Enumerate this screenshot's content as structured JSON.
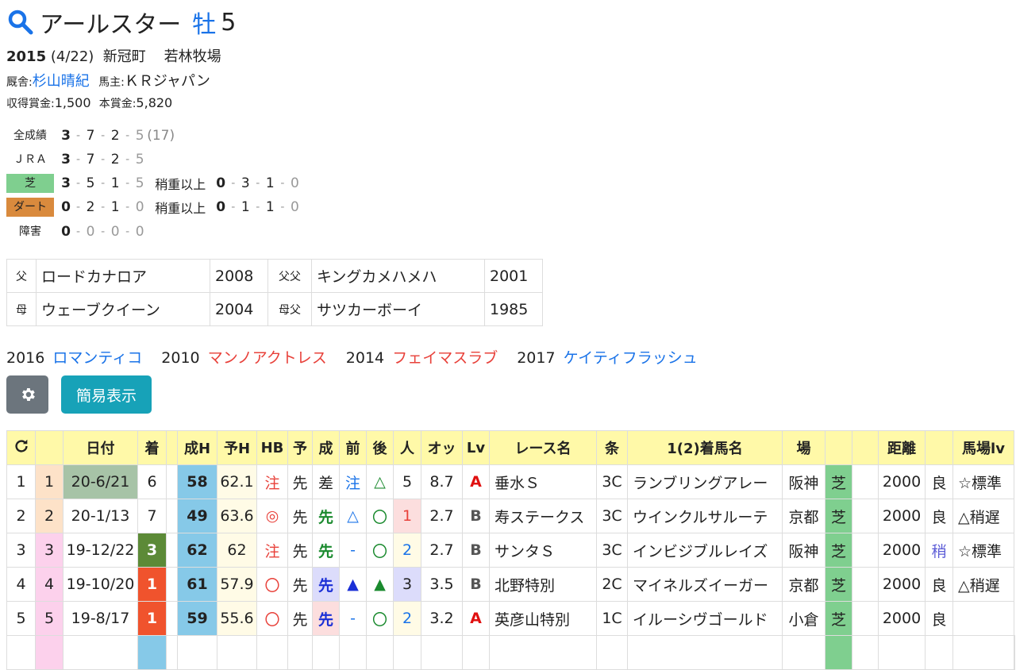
{
  "horse": {
    "name": "アールスター",
    "sex": "牡",
    "age": "5",
    "birth_year": "2015",
    "birth_date": "(4/22)",
    "birth_place": "新冠町",
    "breeder": "若林牧場",
    "trainer_label": "厩舎:",
    "trainer": "杉山晴紀",
    "owner_label": "馬主:",
    "owner": "ＫＲジャパン",
    "earn_label": "収得賞金:",
    "earn": "1,500",
    "prize_label": "本賞金:",
    "prize": "5,820"
  },
  "records": [
    {
      "label": "全成績",
      "kind": "plain",
      "nums": [
        "3",
        "7",
        "2",
        "5"
      ],
      "total": "(17)"
    },
    {
      "label": "ＪＲＡ",
      "kind": "plain",
      "nums": [
        "3",
        "7",
        "2",
        "5"
      ]
    },
    {
      "label": "芝",
      "kind": "turf",
      "nums": [
        "3",
        "5",
        "1",
        "5"
      ],
      "heavy_label": "稍重以上",
      "heavy": [
        "0",
        "3",
        "1",
        "0"
      ]
    },
    {
      "label": "ダート",
      "kind": "dirt",
      "nums": [
        "0",
        "2",
        "1",
        "0"
      ],
      "heavy_label": "稍重以上",
      "heavy": [
        "0",
        "1",
        "1",
        "0"
      ]
    },
    {
      "label": "障害",
      "kind": "plain",
      "nums": [
        "0",
        "0",
        "0",
        "0"
      ]
    }
  ],
  "pedigree": {
    "sire_key": "父",
    "sire": "ロードカナロア",
    "sire_year": "2008",
    "sire_sire_key": "父父",
    "sire_sire": "キングカメハメハ",
    "sire_sire_year": "2001",
    "dam_key": "母",
    "dam": "ウェーブクイーン",
    "dam_year": "2004",
    "dam_sire_key": "母父",
    "dam_sire": "サツカーボーイ",
    "dam_sire_year": "1985"
  },
  "siblings": [
    {
      "year": "2016",
      "name": "ロマンティコ",
      "color": "#1a73e8"
    },
    {
      "year": "2010",
      "name": "マンノアクトレス",
      "color": "#e8413a"
    },
    {
      "year": "2014",
      "name": "フェイマスラブ",
      "color": "#e8413a"
    },
    {
      "year": "2017",
      "name": "ケイティフラッシュ",
      "color": "#1a73e8"
    }
  ],
  "buttons": {
    "settings_icon": "gear-icon",
    "simple_view": "簡易表示"
  },
  "table": {
    "refresh_icon": "refresh-icon",
    "headers": [
      "",
      "日付",
      "着",
      "",
      "成H",
      "予H",
      "HB",
      "予",
      "成",
      "前",
      "後",
      "人",
      "オッ",
      "Lv",
      "レース名",
      "条",
      "1(2)着馬名",
      "場",
      "",
      "",
      "距離",
      "",
      "馬場lv"
    ],
    "rows": [
      {
        "no": "1",
        "rank": "1",
        "date": "20-6/21",
        "chaku": "6",
        "seiH": "58",
        "yoH": "62.1",
        "hb": "注",
        "yo": "先",
        "sei": "差",
        "mae": "注",
        "ato": "△",
        "ninki": "5",
        "odds": "8.7",
        "lv": "A",
        "race": "垂水Ｓ",
        "jou": "3C",
        "winner": "ランブリングアレー",
        "ba": "阪神",
        "surface": "芝",
        "dist": "2000",
        "cond": "良",
        "babalv": "☆標準"
      },
      {
        "no": "2",
        "rank": "2",
        "date": "20-1/13",
        "chaku": "7",
        "seiH": "49",
        "yoH": "63.6",
        "hb": "◎",
        "yo": "先",
        "sei": "先",
        "mae": "△",
        "ato": "〇",
        "ninki": "1",
        "odds": "2.7",
        "lv": "B",
        "race": "寿ステークス",
        "jou": "3C",
        "winner": "ウインクルサルーテ",
        "ba": "京都",
        "surface": "芝",
        "dist": "2000",
        "cond": "良",
        "babalv": "△稍遅"
      },
      {
        "no": "3",
        "rank": "3",
        "date": "19-12/22",
        "chaku": "3",
        "seiH": "62",
        "yoH": "62",
        "hb": "注",
        "yo": "先",
        "sei": "先",
        "mae": "-",
        "ato": "〇",
        "ninki": "2",
        "odds": "2.7",
        "lv": "B",
        "race": "サンタＳ",
        "jou": "3C",
        "winner": "インビジブルレイズ",
        "ba": "阪神",
        "surface": "芝",
        "dist": "2000",
        "cond": "稍",
        "babalv": "☆標準"
      },
      {
        "no": "4",
        "rank": "4",
        "date": "19-10/20",
        "chaku": "1",
        "seiH": "61",
        "yoH": "57.9",
        "hb": "〇",
        "yo": "先",
        "sei": "先",
        "mae": "▲",
        "ato": "▲",
        "ninki": "3",
        "odds": "3.5",
        "lv": "B",
        "race": "北野特別",
        "jou": "2C",
        "winner": "マイネルズイーガー",
        "ba": "京都",
        "surface": "芝",
        "dist": "2000",
        "cond": "良",
        "babalv": "△稍遅"
      },
      {
        "no": "5",
        "rank": "5",
        "date": "19-8/17",
        "chaku": "1",
        "seiH": "59",
        "yoH": "55.6",
        "hb": "〇",
        "yo": "先",
        "sei": "先",
        "mae": "-",
        "ato": "〇",
        "ninki": "2",
        "odds": "3.2",
        "lv": "A",
        "race": "英彦山特別",
        "jou": "1C",
        "winner": "イルーシヴゴールド",
        "ba": "小倉",
        "surface": "芝",
        "dist": "2000",
        "cond": "良",
        "babalv": ""
      }
    ]
  }
}
